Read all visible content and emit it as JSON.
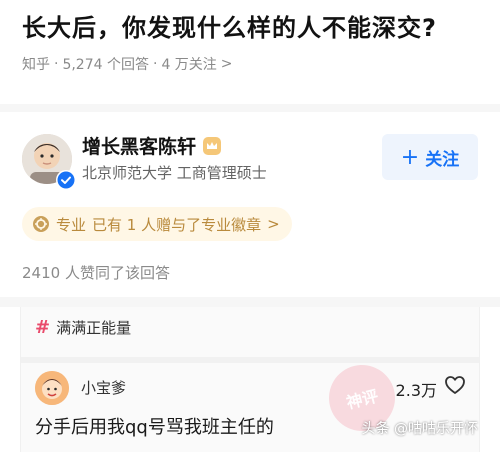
{
  "question": {
    "title": "长大后，你发现什么样的人不能深交?",
    "meta_source": "知乎",
    "meta_sep": "·",
    "meta_answers": "5,274 个回答",
    "meta_sep2": "·",
    "meta_followers": "4 万关注",
    "meta_arrow": ">"
  },
  "author": {
    "name": "增长黑客陈轩",
    "description": "北京师范大学 工商管理硕士",
    "follow_plus": "+",
    "follow_label": "关注"
  },
  "badge": {
    "label": "专业",
    "text": "已有 1 人赠与了专业徽章",
    "arrow": ">"
  },
  "agree": {
    "text": "2410 人赞同了该回答"
  },
  "comment": {
    "topic_hash": "#",
    "topic": "满满正能量",
    "commenter_name": "小宝爹",
    "like_count": "2.3万",
    "text": "分手后用我qq号骂我班主任的",
    "stamp_text": "神评"
  },
  "watermark": {
    "text": "头条 @咕咕乐开怀"
  },
  "colors": {
    "accent": "#1772f6",
    "badge": "#b98a3c",
    "topic_hash": "#e94a6b"
  }
}
